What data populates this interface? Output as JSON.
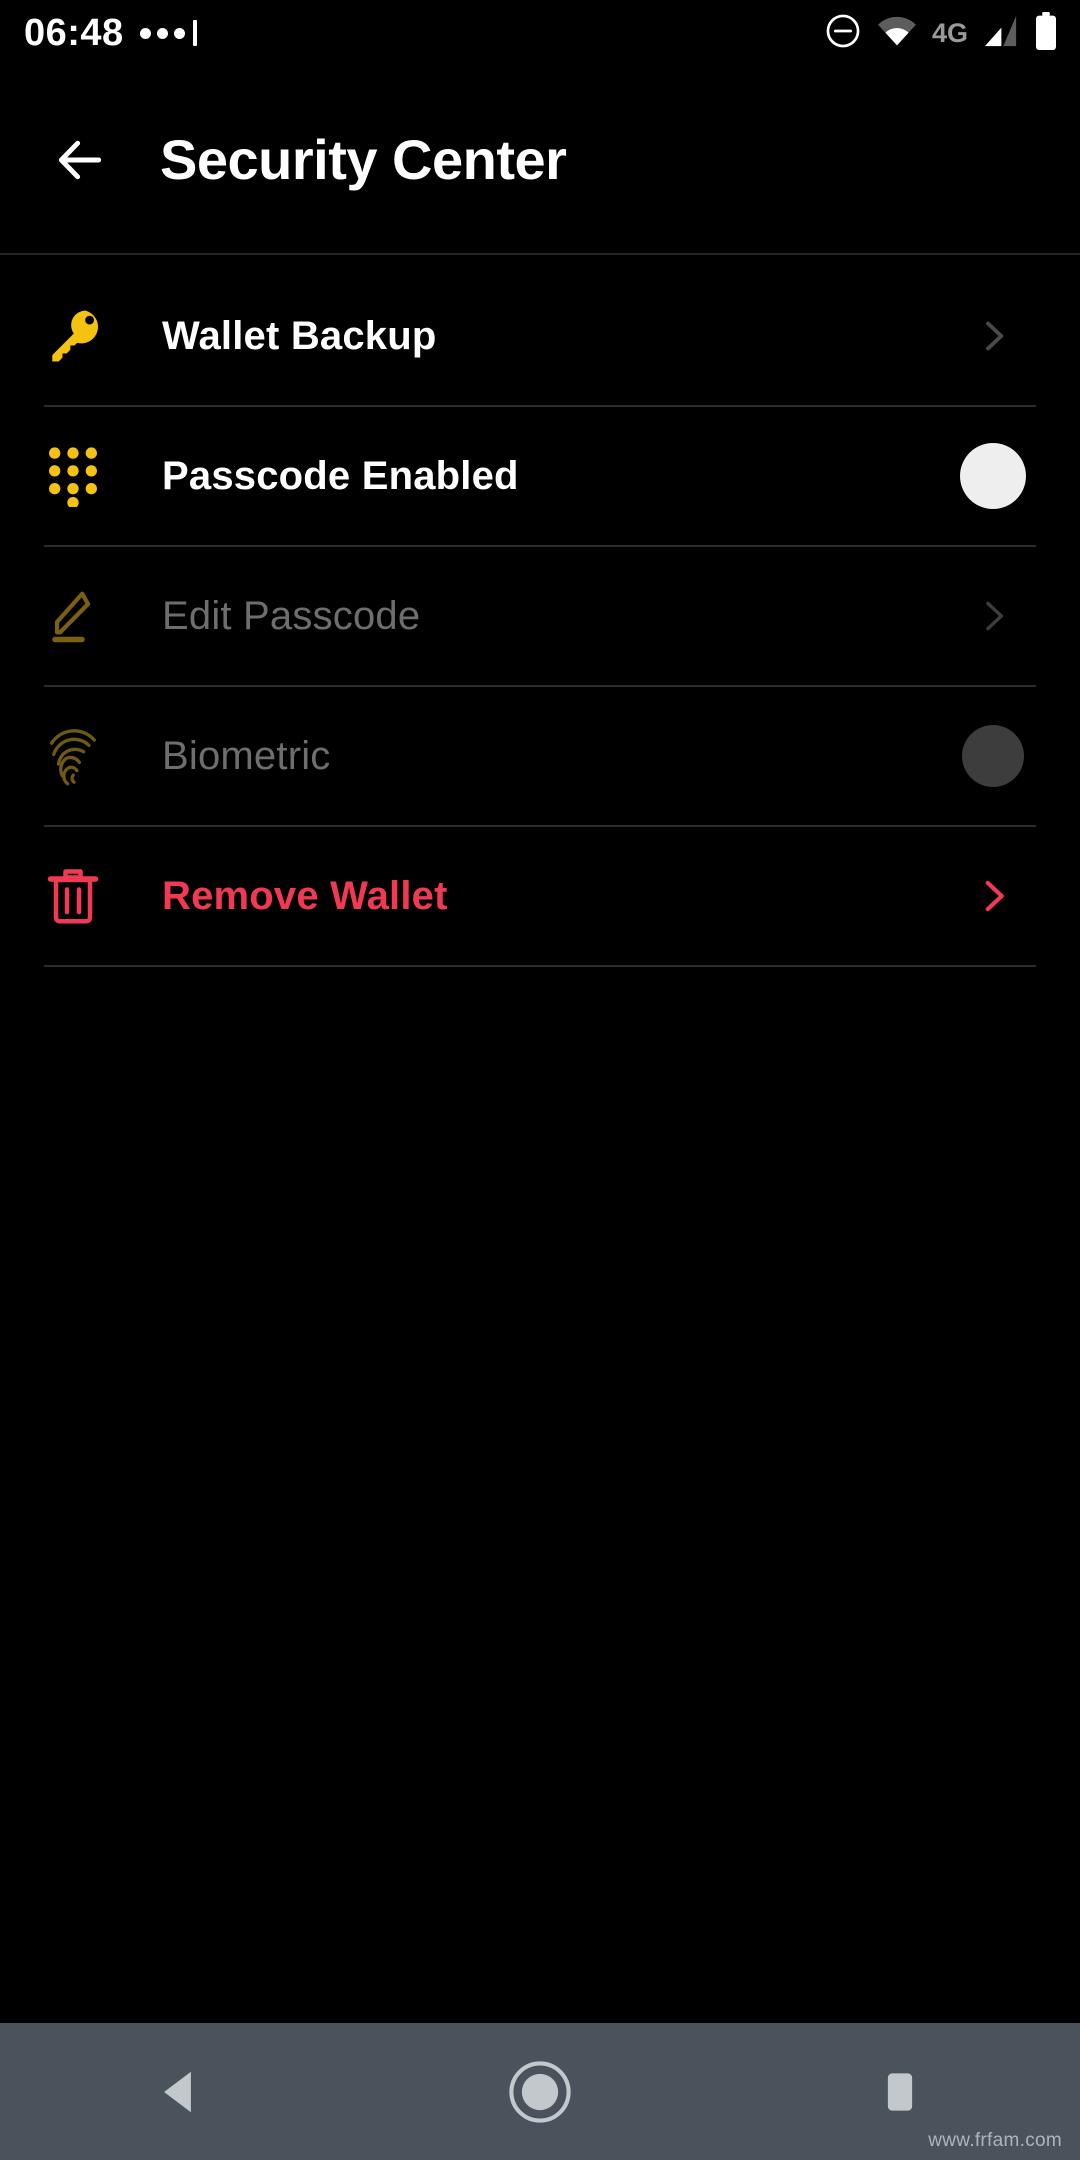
{
  "statusbar": {
    "time": "06:48",
    "notification_dots": "•••",
    "network_type": "4G",
    "icons": [
      "dnd-icon",
      "wifi-icon",
      "signal-icon",
      "battery-icon"
    ]
  },
  "header": {
    "back_label": "Back",
    "title": "Security Center"
  },
  "list": {
    "items": [
      {
        "id": "wallet-backup",
        "label": "Wallet Backup",
        "icon": "key-icon",
        "icon_color": "#f5c211",
        "accessory": "chevron-right-icon",
        "state": "enabled"
      },
      {
        "id": "passcode-enabled",
        "label": "Passcode Enabled",
        "icon": "keypad-icon",
        "icon_color": "#f5c211",
        "accessory": "toggle-on",
        "state": "enabled"
      },
      {
        "id": "edit-passcode",
        "label": "Edit Passcode",
        "icon": "pencil-icon",
        "icon_color": "#7a6010",
        "accessory": "chevron-right-icon",
        "state": "disabled"
      },
      {
        "id": "biometric",
        "label": "Biometric",
        "icon": "fingerprint-icon",
        "icon_color": "#6e5a14",
        "accessory": "toggle-off",
        "state": "disabled"
      },
      {
        "id": "remove-wallet",
        "label": "Remove Wallet",
        "icon": "trash-icon",
        "icon_color": "#f03a54",
        "accessory": "chevron-right-icon",
        "state": "danger"
      }
    ]
  },
  "navbar": {
    "back": "back-nav-button",
    "home": "home-nav-button",
    "recents": "recents-nav-button"
  },
  "watermark": "www.frfam.com",
  "colors": {
    "background": "#000000",
    "accent_yellow": "#f5c211",
    "danger_red": "#f03a54",
    "divider": "#2b2b2b",
    "disabled_text": "#6e6e6e",
    "navbar": "#4a525b"
  }
}
